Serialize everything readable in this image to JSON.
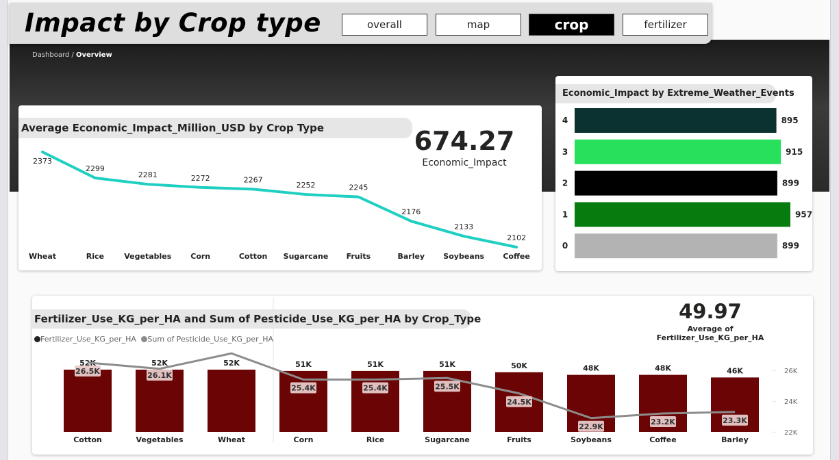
{
  "page": {
    "title": "Impact by Crop type",
    "breadcrumb_root": "Dashboard / ",
    "breadcrumb_current": "Overview"
  },
  "nav": [
    {
      "label": "overall",
      "active": false
    },
    {
      "label": "map",
      "active": false
    },
    {
      "label": "crop",
      "active": true
    },
    {
      "label": "fertilizer",
      "active": false
    }
  ],
  "line_card": {
    "title": "Average Economic_Impact_Million_USD by Crop Type",
    "kpi_value": "674.27",
    "kpi_label": "Economic_Impact"
  },
  "bar_card": {
    "title": "Economic_Impact by Extreme_Weather_Events"
  },
  "combo_card": {
    "title": "Fertilizer_Use_KG_per_HA and Sum of Pesticide_Use_KG_per_HA by Crop_Type",
    "legend_a": "Fertilizer_Use_KG_per_HA",
    "legend_b": "Sum of Pesticide_Use_KG_per_HA",
    "kpi_value": "49.97",
    "kpi_label": "Average of Fertilizer_Use_KG_per_HA"
  },
  "colors": {
    "line": "#1fcfc2",
    "combo_bar": "#6b0505",
    "combo_line": "#8c8c8c"
  },
  "chart_data": [
    {
      "type": "line",
      "title": "Average Economic_Impact_Million_USD by Crop Type",
      "categories": [
        "Wheat",
        "Rice",
        "Vegetables",
        "Corn",
        "Cotton",
        "Sugarcane",
        "Fruits",
        "Barley",
        "Soybeans",
        "Coffee"
      ],
      "values": [
        2373,
        2299,
        2281,
        2272,
        2267,
        2252,
        2245,
        2176,
        2133,
        2102
      ],
      "labels": [
        "2373",
        "2299",
        "2281",
        "2272",
        "2267",
        "2252",
        "2245",
        "2176",
        "2133",
        "2102"
      ],
      "color": "#1fcfc2"
    },
    {
      "type": "bar",
      "orientation": "horizontal",
      "title": "Economic_Impact by Extreme_Weather_Events",
      "categories": [
        "4",
        "3",
        "2",
        "1",
        "0"
      ],
      "values": [
        895,
        915,
        899,
        957,
        899
      ],
      "labels": [
        "895",
        "915",
        "899",
        "957",
        "899"
      ],
      "colors": [
        "#0b3130",
        "#28e05c",
        "#000000",
        "#067b0e",
        "#b3b3b3"
      ]
    },
    {
      "type": "bar",
      "title": "Fertilizer_Use_KG_per_HA and Sum of Pesticide_Use_KG_per_HA by Crop_Type",
      "categories": [
        "Cotton",
        "Vegetables",
        "Wheat",
        "Corn",
        "Rice",
        "Sugarcane",
        "Fruits",
        "Soybeans",
        "Coffee",
        "Barley"
      ],
      "series": [
        {
          "name": "Fertilizer_Use_KG_per_HA",
          "type": "bar",
          "values": [
            52000,
            52000,
            52000,
            51000,
            51000,
            51000,
            50000,
            48000,
            48000,
            46000
          ],
          "labels": [
            "52K",
            "52K",
            "52K",
            "51K",
            "51K",
            "51K",
            "50K",
            "48K",
            "48K",
            "46K"
          ]
        },
        {
          "name": "Sum of Pesticide_Use_KG_per_HA",
          "type": "line",
          "axis": "right",
          "values": [
            26500,
            26100,
            27100,
            25400,
            25400,
            25500,
            24500,
            22900,
            23200,
            23300
          ],
          "labels": [
            "26.5K",
            "26.1K",
            "",
            "25.4K",
            "25.4K",
            "25.5K",
            "24.5K",
            "22.9K",
            "23.2K",
            "23.3K"
          ]
        }
      ],
      "y2_ticks": [
        "26K",
        "24K",
        "22K"
      ],
      "y2_tick_values": [
        26000,
        24000,
        22000
      ]
    }
  ]
}
